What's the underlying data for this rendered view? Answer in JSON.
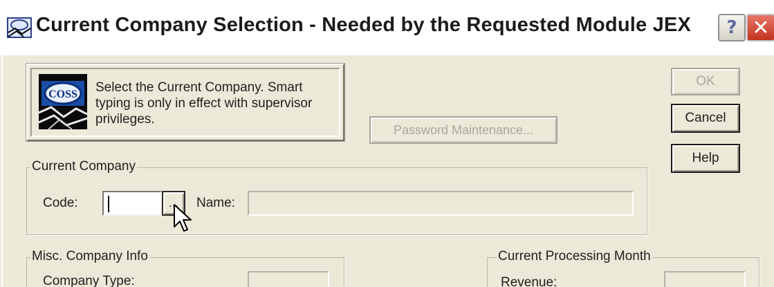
{
  "window": {
    "title": "Current Company Selection - Needed by the Requested Module JEX",
    "icon": "coss-app-icon",
    "controls": {
      "help": "?",
      "close": "✕"
    }
  },
  "info": {
    "logo": "coss-logo",
    "text": "Select the Current Company. Smart typing is only in effect with supervisor privileges."
  },
  "buttons": {
    "ok": "OK",
    "cancel": "Cancel",
    "help": "Help",
    "password": "Password Maintenance...",
    "lookup": "..."
  },
  "current_company": {
    "group_label": "Current Company",
    "code_label": "Code:",
    "code_value": "",
    "name_label": "Name:",
    "name_value": ""
  },
  "misc": {
    "group_label": "Misc. Company Info",
    "company_type_label": "Company Type:"
  },
  "processing": {
    "group_label": "Current Processing Month",
    "revenue_label": "Revenue:"
  },
  "colors": {
    "dialog_bg": "#ece9d8",
    "close_red": "#c4321e"
  }
}
